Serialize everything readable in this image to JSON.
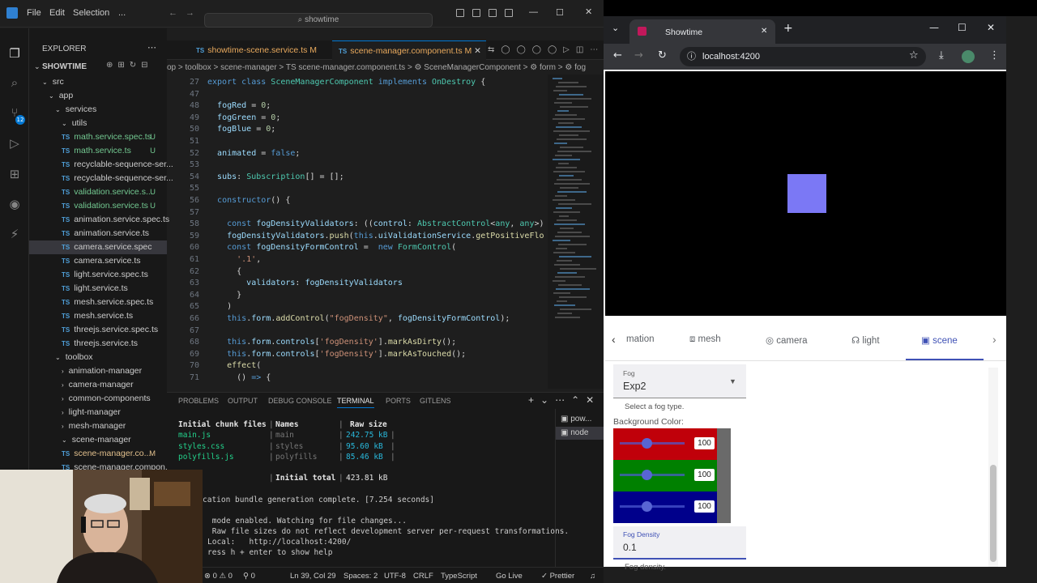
{
  "vscode": {
    "menu": [
      "File",
      "Edit",
      "Selection",
      "..."
    ],
    "search_label": "showtime",
    "explorer_title": "EXPLORER",
    "root_folder": "SHOWTIME",
    "scm_badge": "12",
    "tree": [
      {
        "label": "src",
        "kind": "folder",
        "depth": 0,
        "status": ""
      },
      {
        "label": "app",
        "kind": "folder",
        "depth": 1,
        "status": ""
      },
      {
        "label": "services",
        "kind": "folder",
        "depth": 2,
        "status": ""
      },
      {
        "label": "utils",
        "kind": "folder",
        "depth": 3,
        "status": ""
      },
      {
        "label": "math.service.spec.ts",
        "kind": "ts",
        "depth": 4,
        "status": "U"
      },
      {
        "label": "math.service.ts",
        "kind": "ts",
        "depth": 4,
        "status": "U"
      },
      {
        "label": "recyclable-sequence-ser...",
        "kind": "ts",
        "depth": 4,
        "status": ""
      },
      {
        "label": "recyclable-sequence-ser...",
        "kind": "ts",
        "depth": 4,
        "status": ""
      },
      {
        "label": "validation.service.s...",
        "kind": "ts",
        "depth": 4,
        "status": "U"
      },
      {
        "label": "validation.service.ts",
        "kind": "ts",
        "depth": 4,
        "status": "U"
      },
      {
        "label": "animation.service.spec.ts",
        "kind": "ts",
        "depth": 3,
        "status": ""
      },
      {
        "label": "animation.service.ts",
        "kind": "ts",
        "depth": 3,
        "status": ""
      },
      {
        "label": "camera.service.spec",
        "kind": "ts",
        "depth": 3,
        "status": ""
      },
      {
        "label": "camera.service.ts",
        "kind": "ts",
        "depth": 3,
        "status": ""
      },
      {
        "label": "light.service.spec.ts",
        "kind": "ts",
        "depth": 3,
        "status": ""
      },
      {
        "label": "light.service.ts",
        "kind": "ts",
        "depth": 3,
        "status": ""
      },
      {
        "label": "mesh.service.spec.ts",
        "kind": "ts",
        "depth": 3,
        "status": ""
      },
      {
        "label": "mesh.service.ts",
        "kind": "ts",
        "depth": 3,
        "status": ""
      },
      {
        "label": "threejs.service.spec.ts",
        "kind": "ts",
        "depth": 3,
        "status": ""
      },
      {
        "label": "threejs.service.ts",
        "kind": "ts",
        "depth": 3,
        "status": ""
      },
      {
        "label": "toolbox",
        "kind": "folder",
        "depth": 2,
        "status": ""
      },
      {
        "label": "animation-manager",
        "kind": "cfolder",
        "depth": 3,
        "status": ""
      },
      {
        "label": "camera-manager",
        "kind": "cfolder",
        "depth": 3,
        "status": ""
      },
      {
        "label": "common-components",
        "kind": "cfolder",
        "depth": 3,
        "status": ""
      },
      {
        "label": "light-manager",
        "kind": "cfolder",
        "depth": 3,
        "status": ""
      },
      {
        "label": "mesh-manager",
        "kind": "cfolder",
        "depth": 3,
        "status": ""
      },
      {
        "label": "scene-manager",
        "kind": "folder",
        "depth": 3,
        "status": ""
      },
      {
        "label": "scene-manager.co...",
        "kind": "ts",
        "depth": 4,
        "status": "M"
      },
      {
        "label": "scene-manager.compon...",
        "kind": "ts",
        "depth": 4,
        "status": ""
      }
    ],
    "tabs": [
      {
        "label": "showtime-scene.service.ts",
        "status": "M",
        "active": false
      },
      {
        "label": "scene-manager.component.ts",
        "status": "M",
        "active": true
      }
    ],
    "breadcrumb": "op > toolbox > scene-manager > TS scene-manager.component.ts > ⚙ SceneManagerComponent > ⚙ form > ⚙ fog",
    "code_lines": [
      {
        "n": "27",
        "html": "<span class='kw'>export</span> <span class='kw'>class</span> <span class='cls'>SceneManagerComponent</span> <span class='kw'>implements</span> <span class='cls'>OnDestroy</span> {"
      },
      {
        "n": "47",
        "html": ""
      },
      {
        "n": "48",
        "html": "  <span class='var'>fogRed</span> = <span class='num'>0</span>;"
      },
      {
        "n": "49",
        "html": "  <span class='var'>fogGreen</span> = <span class='num'>0</span>;"
      },
      {
        "n": "50",
        "html": "  <span class='var'>fogBlue</span> = <span class='num'>0</span>;"
      },
      {
        "n": "51",
        "html": ""
      },
      {
        "n": "52",
        "html": "  <span class='var'>animated</span> = <span class='kw'>false</span>;"
      },
      {
        "n": "53",
        "html": ""
      },
      {
        "n": "54",
        "html": "  <span class='var'>subs</span>: <span class='cls'>Subscription</span>[] = [];"
      },
      {
        "n": "55",
        "html": ""
      },
      {
        "n": "56",
        "html": "  <span class='kw'>constructor</span>() {"
      },
      {
        "n": "57",
        "html": ""
      },
      {
        "n": "58",
        "html": "    <span class='kw'>const</span> <span class='var'>fogDensityValidators</span>: ((<span class='var'>control</span>: <span class='cls'>AbstractControl</span>&lt;<span class='cls'>any</span>, <span class='cls'>any</span>&gt;)"
      },
      {
        "n": "59",
        "html": "    <span class='var'>fogDensityValidators</span>.<span class='fn'>push</span>(<span class='kw'>this</span>.<span class='var'>uiValidationService</span>.<span class='fn'>getPositiveFlo</span>"
      },
      {
        "n": "60",
        "html": "    <span class='kw'>const</span> <span class='var'>fogDensityFormControl</span> =  <span class='kw'>new</span> <span class='cls'>FormControl</span>("
      },
      {
        "n": "61",
        "html": "      <span class='str'>'.1'</span>,"
      },
      {
        "n": "62",
        "html": "      {"
      },
      {
        "n": "63",
        "html": "        <span class='var'>validators</span>: <span class='var'>fogDensityValidators</span>"
      },
      {
        "n": "64",
        "html": "      }"
      },
      {
        "n": "65",
        "html": "    )"
      },
      {
        "n": "66",
        "html": "    <span class='kw'>this</span>.<span class='var'>form</span>.<span class='fn'>addControl</span>(<span class='str'>\"fogDensity\"</span>, <span class='var'>fogDensityFormControl</span>);"
      },
      {
        "n": "67",
        "html": ""
      },
      {
        "n": "68",
        "html": "    <span class='kw'>this</span>.<span class='var'>form</span>.<span class='var'>controls</span>[<span class='str'>'fogDensity'</span>].<span class='fn'>markAsDirty</span>();"
      },
      {
        "n": "69",
        "html": "    <span class='kw'>this</span>.<span class='var'>form</span>.<span class='var'>controls</span>[<span class='str'>'fogDensity'</span>].<span class='fn'>markAsTouched</span>();"
      },
      {
        "n": "70",
        "html": "    <span class='fn'>effect</span>("
      },
      {
        "n": "71",
        "html": "      () <span class='kw'>=&gt;</span> {"
      }
    ],
    "panel_tabs": [
      "PROBLEMS",
      "OUTPUT",
      "DEBUG CONSOLE",
      "TERMINAL",
      "PORTS",
      "GITLENS"
    ],
    "active_panel_tab": "TERMINAL",
    "terminal_instances": [
      "pow...",
      "node"
    ],
    "terminal_header": {
      "c1": "Initial chunk files",
      "c2": "Names",
      "c3": "Raw size"
    },
    "terminal_rows": [
      {
        "file": "main.js",
        "name": "main",
        "size": "242.75 kB"
      },
      {
        "file": "styles.css",
        "name": "styles",
        "size": "95.60 kB"
      },
      {
        "file": "polyfills.js",
        "name": "polyfills",
        "size": "85.46 kB"
      }
    ],
    "terminal_total_label": "Initial total",
    "terminal_total": "423.81 kB",
    "terminal_lines": [
      "cation bundle generation complete. [7.254 seconds]",
      "",
      " mode enabled. Watching for file changes...",
      " Raw file sizes do not reflect development server per-request transformations.",
      "Local:   http://localhost:4200/",
      "ress h + enter to show help"
    ],
    "status": {
      "errors": "⊗ 0 ⚠ 0",
      "ports": "⚲ 0",
      "position": "Ln 39, Col 29",
      "spaces": "Spaces: 2",
      "encoding": "UTF-8",
      "eol": "CRLF",
      "lang": "TypeScript",
      "golive": "Go Live",
      "prettier": "✓ Prettier"
    }
  },
  "browser": {
    "tab_title": "Showtime",
    "url": "localhost:4200",
    "nav_tabs": [
      {
        "label": "mation",
        "icon": ""
      },
      {
        "label": "mesh",
        "icon": "mesh-icon"
      },
      {
        "label": "camera",
        "icon": "camera-icon"
      },
      {
        "label": "light",
        "icon": "light-icon"
      },
      {
        "label": "scene",
        "icon": "scene-icon",
        "active": true
      }
    ],
    "fog_label": "Fog",
    "fog_value": "Exp2",
    "fog_hint": "Select a fog type.",
    "bg_color_label": "Background Color:",
    "sliders": [
      {
        "channel": "red",
        "value": "100",
        "color": "#c0000a"
      },
      {
        "channel": "green",
        "value": "100",
        "color": "#008000"
      },
      {
        "channel": "blue",
        "value": "100",
        "color": "#00008b"
      }
    ],
    "density_label": "Fog Density",
    "density_value": "0.1",
    "density_hint": "Fog density.",
    "cube_color": "#7b78f5",
    "accent": "#3f51b5"
  }
}
